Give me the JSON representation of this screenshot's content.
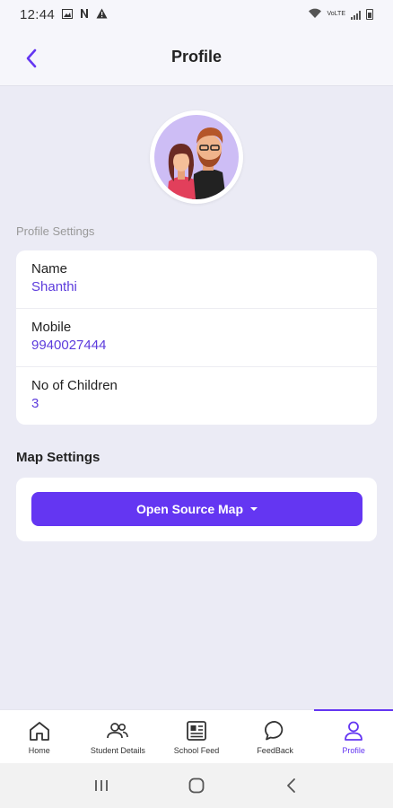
{
  "status_bar": {
    "time": "12:44",
    "network_label": "VoLTE",
    "left_icons": [
      "image-icon",
      "n-icon",
      "warning-icon"
    ],
    "right_icons": [
      "wifi-icon",
      "signal-icon",
      "battery-icon"
    ]
  },
  "header": {
    "title": "Profile",
    "back_icon": "chevron-left-icon"
  },
  "profile_settings": {
    "section_label": "Profile Settings",
    "fields": [
      {
        "label": "Name",
        "value": "Shanthi"
      },
      {
        "label": "Mobile",
        "value": "9940027444"
      },
      {
        "label": "No of Children",
        "value": "3"
      }
    ]
  },
  "map_settings": {
    "title": "Map Settings",
    "button_label": "Open Source Map"
  },
  "bottom_nav": {
    "items": [
      {
        "label": "Home",
        "icon": "home-icon"
      },
      {
        "label": "Student Details",
        "icon": "users-icon"
      },
      {
        "label": "School Feed",
        "icon": "newspaper-icon"
      },
      {
        "label": "FeedBack",
        "icon": "chat-bubble-icon"
      },
      {
        "label": "Profile",
        "icon": "user-icon"
      }
    ],
    "active_index": 4
  },
  "colors": {
    "accent": "#6436F2",
    "value_text": "#5C3BDC",
    "background": "#EBEBF5",
    "avatar_bg": "#CDBDF5"
  }
}
